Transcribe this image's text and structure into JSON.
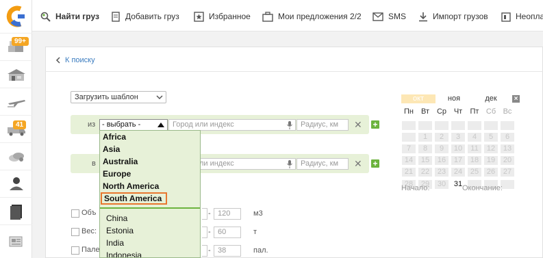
{
  "nav": [
    {
      "label": "Найти груз",
      "icon": "find-cargo-icon",
      "bold": true
    },
    {
      "label": "Добавить груз",
      "icon": "add-cargo-icon"
    },
    {
      "label": "Избранное",
      "icon": "favorites-icon"
    },
    {
      "label": "Мои предложения 2/2",
      "icon": "offers-icon"
    },
    {
      "label": "SMS",
      "icon": "sms-icon"
    },
    {
      "label": "Импорт грузов",
      "icon": "import-icon"
    },
    {
      "label": "Неопла",
      "icon": "unpaid-icon"
    }
  ],
  "sidebar": {
    "badges": {
      "cargo": "99+",
      "trucks": "41"
    }
  },
  "back_link": "К поиску",
  "template_select": "Загрузить шаблон",
  "from_row": {
    "label": "из",
    "select_value": "- выбрать -",
    "city_placeholder": "Город или индекс",
    "radius_placeholder": "Радиус, км"
  },
  "to_row": {
    "label": "в",
    "city_placeholder": "Город или индекс",
    "radius_placeholder": "Радиус, км"
  },
  "dropdown": {
    "regions": [
      "Africa",
      "Asia",
      "Australia",
      "Europe",
      "North America",
      "South America"
    ],
    "selected": "South America",
    "countries": [
      "China",
      "Estonia",
      "India",
      "Indonesia"
    ]
  },
  "filters": [
    {
      "label": "Объ",
      "value": "120",
      "unit": "м3"
    },
    {
      "label": "Вес:",
      "value": "60",
      "unit": "т"
    },
    {
      "label": "Пале",
      "value": "38",
      "unit": "пал."
    }
  ],
  "filter_dash": "-",
  "calendar": {
    "months": [
      "окт",
      "ноя",
      "дек"
    ],
    "active_month": "окт",
    "weekdays": [
      "Пн",
      "Вт",
      "Ср",
      "Чт",
      "Пт",
      "Сб",
      "Вс"
    ],
    "weeks": [
      [
        "",
        "",
        "",
        "",
        "",
        "",
        ""
      ],
      [
        "",
        "1",
        "2",
        "3",
        "4",
        "5",
        "6"
      ],
      [
        "7",
        "8",
        "9",
        "10",
        "11",
        "12",
        "13"
      ],
      [
        "14",
        "15",
        "16",
        "17",
        "18",
        "19",
        "20"
      ],
      [
        "21",
        "22",
        "23",
        "24",
        "25",
        "26",
        "27"
      ],
      [
        "28",
        "29",
        "30",
        "31",
        "",
        "",
        ""
      ]
    ],
    "today": "31",
    "start_label": "Начало:",
    "end_label": "Окончание:",
    "close": "×"
  },
  "colors": {
    "accent": "#e8772e",
    "green": "#6cb33e",
    "row_bg": "#e7f1d8",
    "link": "#3a7bbf"
  }
}
